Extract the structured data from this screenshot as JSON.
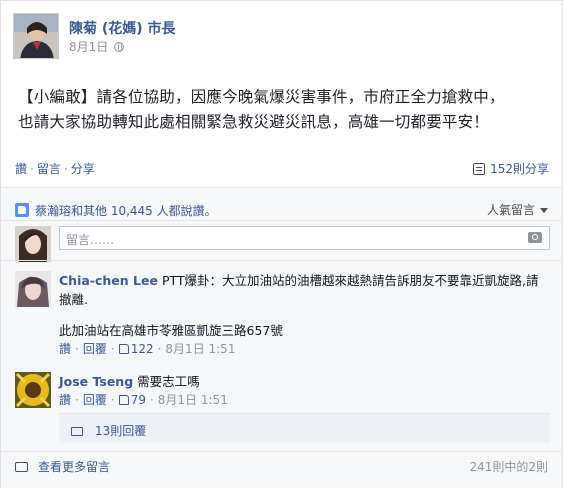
{
  "post": {
    "author": "陳菊 (花媽) 市長",
    "date": "8月1日",
    "privacy_icon": "globe-icon",
    "text_line1": "【小編敢】請各位協助，因應今晚氣爆災害事件，市府正全力搶救中，",
    "text_line2": "也請大家協助轉知此處相關緊急救災避災訊息，高雄一切都要平安！"
  },
  "actions": {
    "like": "讚",
    "comment": "留言",
    "share": "分享",
    "share_count": "152則分享"
  },
  "likes": {
    "summary": "蔡瀚瑢和其他 10,445 人都說讚。",
    "sort_label": "人氣留言"
  },
  "comment_input": {
    "placeholder": "留言……"
  },
  "comments": [
    {
      "author": "Chia-chen Lee",
      "text": "PTT爆卦：大立加油站的油槽越來越熱請告訴朋友不要靠近凱旋路,請撤離.",
      "extra": "此加油站在高雄市苓雅區凱旋三路657號",
      "like_label": "讚",
      "reply_label": "回覆",
      "likes": "122",
      "time": "8月1日 1:51"
    },
    {
      "author": "Jose Tseng",
      "text": "需要志工嗎",
      "like_label": "讚",
      "reply_label": "回覆",
      "likes": "79",
      "time": "8月1日 1:51"
    }
  ],
  "replies": {
    "label": "13則回覆"
  },
  "footer": {
    "more": "查看更多留言",
    "count": "241則中的2則"
  },
  "colors": {
    "link": "#3b5998",
    "muted": "#90949c",
    "ufi_bg": "#f6f7f9"
  }
}
